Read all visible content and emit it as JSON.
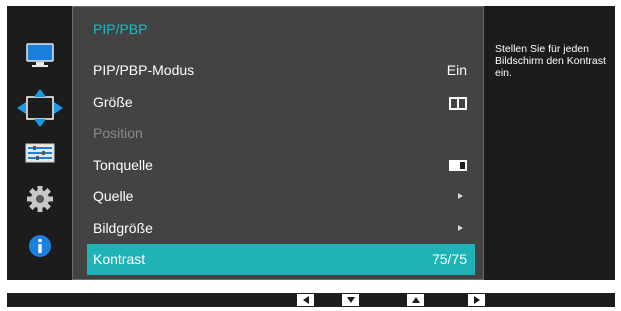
{
  "menu": {
    "title": "PIP/PBP",
    "items": [
      {
        "label": "PIP/PBP-Modus",
        "value": "Ein"
      },
      {
        "label": "Größe",
        "value_icon": "pbp-size-icon"
      },
      {
        "label": "Position",
        "state": "disabled"
      },
      {
        "label": "Tonquelle",
        "value_icon": "sound-source-icon"
      },
      {
        "label": "Quelle",
        "value_icon": "arrow-right-icon"
      },
      {
        "label": "Bildgröße",
        "value_icon": "arrow-right-icon"
      },
      {
        "label": "Kontrast",
        "value": "75/75",
        "state": "selected"
      }
    ]
  },
  "help": {
    "text": "Stellen Sie für jeden Bildschirm den Kontrast ein."
  },
  "sidebar": {
    "icons": [
      "monitor-icon",
      "resize-arrows-icon",
      "sliders-icon",
      "gear-icon",
      "info-icon"
    ],
    "active_index": 1
  },
  "nav": {
    "buttons": [
      "left-arrow-button",
      "down-arrow-button",
      "up-arrow-button",
      "right-arrow-button"
    ]
  },
  "colors": {
    "accent": "#1fb3b7",
    "title": "#21b8c6",
    "panel": "#434343",
    "background": "#1c1c1c",
    "disabled_text": "#8a8a8a"
  }
}
